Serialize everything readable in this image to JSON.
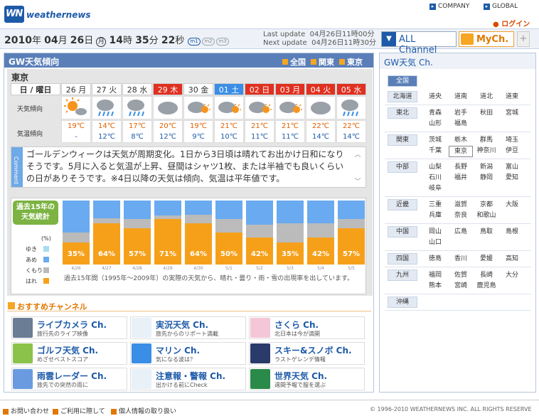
{
  "brand": {
    "logo": "WN",
    "name": "weathernews"
  },
  "toplinks": {
    "company": "COMPANY",
    "global": "GLOBAL",
    "login": "ログイン"
  },
  "clock": {
    "year": "2010",
    "y_unit": "年",
    "month": "04",
    "m_unit": "月",
    "day": "26",
    "d_unit": "日",
    "weekday": "月",
    "hour": "14",
    "h_unit": "時",
    "minute": "35",
    "mi_unit": "分",
    "second": "22",
    "s_unit": "秒"
  },
  "modes": [
    "m1",
    "m2",
    "m3"
  ],
  "update": {
    "last_label": "Last update",
    "last_value": "04月26日11時00分",
    "next_label": "Next update",
    "next_value": "04月26日11時30分"
  },
  "channels": {
    "all": "ALL Channel",
    "mych": "MyCh.",
    "plus": "+"
  },
  "main": {
    "title": "GW天気傾向",
    "nav": [
      "全国",
      "関東",
      "東京"
    ],
    "city": "東京",
    "row_labels": {
      "date": "日 / 曜日",
      "trend": "天気傾向",
      "temp": "気温傾向"
    },
    "days": [
      {
        "label": "26 月",
        "style": "normal",
        "icon": "sun-cloud-icon",
        "max": "19℃",
        "min": "-"
      },
      {
        "label": "27 火",
        "style": "normal",
        "icon": "cloud-rain-icon",
        "max": "14℃",
        "min": "12℃"
      },
      {
        "label": "28 水",
        "style": "normal",
        "icon": "cloud-rain-icon",
        "max": "17℃",
        "min": "8℃"
      },
      {
        "label": "29 木",
        "style": "red",
        "icon": "cloud-icon",
        "max": "20℃",
        "min": "12℃"
      },
      {
        "label": "30 金",
        "style": "normal",
        "icon": "cloud-sun-icon",
        "max": "19℃",
        "min": "9℃"
      },
      {
        "label": "01 土",
        "style": "blue",
        "icon": "cloud-sun-icon",
        "max": "21℃",
        "min": "10℃"
      },
      {
        "label": "02 日",
        "style": "red",
        "icon": "cloud-sun-icon",
        "max": "21℃",
        "min": "11℃"
      },
      {
        "label": "03 月",
        "style": "red",
        "icon": "cloud-sun-icon",
        "max": "21℃",
        "min": "11℃"
      },
      {
        "label": "04 火",
        "style": "red",
        "icon": "cloud-icon",
        "max": "22℃",
        "min": "14℃"
      },
      {
        "label": "05 水",
        "style": "red",
        "icon": "cloud-rain-icon",
        "max": "22℃",
        "min": "14℃"
      }
    ],
    "comment_tab": "Comment",
    "comment": "ゴールデンウィークは天気が周期変化。1日から3日頃は晴れてお出かけ日和になりそうです。5月に入ると気温が上昇、昼間はシャツ1枚、または半袖でも良いくらいの日がありそうです。※4日以降の天気は傾向、気温は平年値です。",
    "stats": {
      "badge_line1": "過去15年の",
      "badge_line2": "天気統計",
      "pct_label": "(%)",
      "legend": [
        {
          "name": "ゆき",
          "color": "#a8dcf0"
        },
        {
          "name": "あめ",
          "color": "#6aaaf0"
        },
        {
          "name": "くもり",
          "color": "#bbbbbb"
        },
        {
          "name": "はれ",
          "color": "#f6a01a"
        }
      ],
      "note": "過去15年間（1995年〜2009年）の実際の天気から、晴れ・曇り・雨・雪の出現率を出しています。"
    }
  },
  "chart_data": {
    "type": "bar",
    "categories": [
      "4/26",
      "4/27",
      "4/28",
      "4/29",
      "4/30",
      "5/1",
      "5/2",
      "5/3",
      "5/4",
      "5/5"
    ],
    "series": [
      {
        "name": "はれ",
        "values": [
          35,
          64,
          57,
          71,
          64,
          50,
          42,
          35,
          42,
          57
        ]
      },
      {
        "name": "くもり",
        "values": [
          15,
          8,
          14,
          6,
          14,
          21,
          20,
          30,
          22,
          14
        ]
      },
      {
        "name": "あめ",
        "values": [
          50,
          28,
          29,
          23,
          22,
          29,
          38,
          35,
          36,
          29
        ]
      },
      {
        "name": "ゆき",
        "values": [
          0,
          0,
          0,
          0,
          0,
          0,
          0,
          0,
          0,
          0
        ]
      }
    ],
    "labels": [
      "35%",
      "64%",
      "57%",
      "71%",
      "64%",
      "50%",
      "42%",
      "35%",
      "42%",
      "57%"
    ],
    "ylim": [
      0,
      100
    ]
  },
  "recommended": {
    "title": "おすすめチャンネル",
    "items": [
      {
        "name": "ライブカメラ Ch.",
        "desc": "旅行先のライブ映像",
        "icon": "live-camera-icon",
        "color": "#6b7d95"
      },
      {
        "name": "実況天気 Ch.",
        "desc": "旅先からのリポート満載",
        "icon": "japan-map-icon",
        "color": "#e8f0f8"
      },
      {
        "name": "さくら Ch.",
        "desc": "北日本は今が満開",
        "icon": "sakura-icon",
        "color": "#f4c6d8"
      },
      {
        "name": "ゴルフ天気 Ch.",
        "desc": "めざせベストスコア",
        "icon": "golf-icon",
        "color": "#8bc34a"
      },
      {
        "name": "マリン Ch.",
        "desc": "気になる波は？",
        "icon": "wave-icon",
        "color": "#3a8ee6"
      },
      {
        "name": "スキー&スノボ Ch.",
        "desc": "ラストゲレンデ情報",
        "icon": "ski-icon",
        "color": "#2a3a6a"
      },
      {
        "name": "雨雲レーダー Ch.",
        "desc": "旅先での突然の雨に",
        "icon": "radar-icon",
        "color": "#6a9be0"
      },
      {
        "name": "注意報・警報 Ch.",
        "desc": "出かける前にCheck",
        "icon": "warning-map-icon",
        "color": "#e8f0f8"
      },
      {
        "name": "世界天気 Ch.",
        "desc": "週間予報で服を選ぶ",
        "icon": "globe-icon",
        "color": "#2a8a4a"
      }
    ]
  },
  "side": {
    "title": "GW天気 Ch.",
    "all": "全国",
    "regions": [
      {
        "name": "北海道",
        "prefs": [
          "道央",
          "道南",
          "道北",
          "道東"
        ]
      },
      {
        "name": "東北",
        "prefs": [
          "青森",
          "岩手",
          "秋田",
          "宮城",
          "山形",
          "福島"
        ]
      },
      {
        "name": "関東",
        "prefs": [
          "茨城",
          "栃木",
          "群馬",
          "埼玉",
          "千葉",
          "東京",
          "神奈川",
          "伊豆"
        ]
      },
      {
        "name": "中部",
        "prefs": [
          "山梨",
          "長野",
          "新潟",
          "富山",
          "石川",
          "福井",
          "静岡",
          "愛知",
          "岐阜"
        ]
      },
      {
        "name": "近畿",
        "prefs": [
          "三重",
          "滋賀",
          "京都",
          "大阪",
          "兵庫",
          "奈良",
          "和歌山"
        ]
      },
      {
        "name": "中国",
        "prefs": [
          "岡山",
          "広島",
          "鳥取",
          "島根",
          "山口"
        ]
      },
      {
        "name": "四国",
        "prefs": [
          "徳島",
          "香川",
          "愛媛",
          "高知"
        ]
      },
      {
        "name": "九州",
        "prefs": [
          "福岡",
          "佐賀",
          "長崎",
          "大分",
          "熊本",
          "宮崎",
          "鹿児島"
        ]
      },
      {
        "name": "沖縄",
        "prefs": []
      }
    ],
    "selected": "東京"
  },
  "footer": {
    "links": [
      "お問い合わせ",
      "ご利用に際して",
      "個人情報の取り扱い"
    ],
    "copyright": "© 1996-2010 WEATHERNEWS INC. ALL RIGHTS RESERVE"
  }
}
